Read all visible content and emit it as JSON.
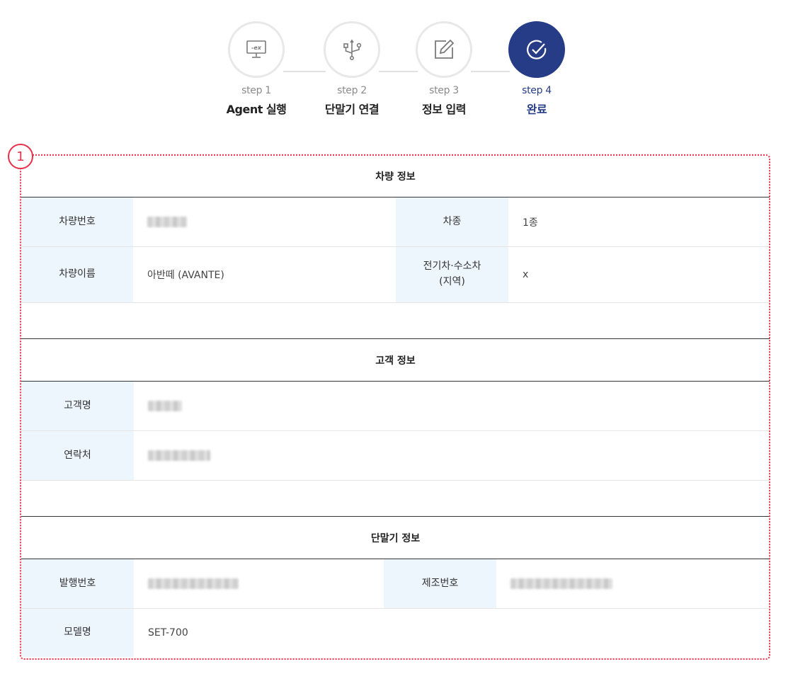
{
  "stepper": {
    "steps": [
      {
        "num": "step 1",
        "title": "Agent 실행",
        "icon": "monitor-ex-icon"
      },
      {
        "num": "step 2",
        "title": "단말기 연결",
        "icon": "usb-icon"
      },
      {
        "num": "step 3",
        "title": "정보 입력",
        "icon": "edit-icon"
      },
      {
        "num": "step 4",
        "title": "완료",
        "icon": "check-circle-icon"
      }
    ],
    "active_step": 4,
    "accent_color": "#263c86"
  },
  "annotation": {
    "marker": "1",
    "color": "#e8304a"
  },
  "vehicle": {
    "title": "차량 정보",
    "rows": [
      {
        "label1": "차량번호",
        "value1": "",
        "label2": "차종",
        "value2": "1종"
      },
      {
        "label1": "차량이름",
        "value1": "아반떼 (AVANTE)",
        "label2a": "전기차·수소차",
        "label2b": "(지역)",
        "value2": "x"
      }
    ]
  },
  "customer": {
    "title": "고객 정보",
    "rows": [
      {
        "label": "고객명",
        "value": ""
      },
      {
        "label": "연락처",
        "value": ""
      }
    ]
  },
  "device": {
    "title": "단말기 정보",
    "rows": [
      {
        "label1": "발행번호",
        "value1": "",
        "label2": "제조번호",
        "value2": ""
      },
      {
        "label1": "모델명",
        "value1": "SET-700"
      }
    ]
  },
  "colors": {
    "label_bg": "#eef6fd",
    "divider": "#333333"
  }
}
